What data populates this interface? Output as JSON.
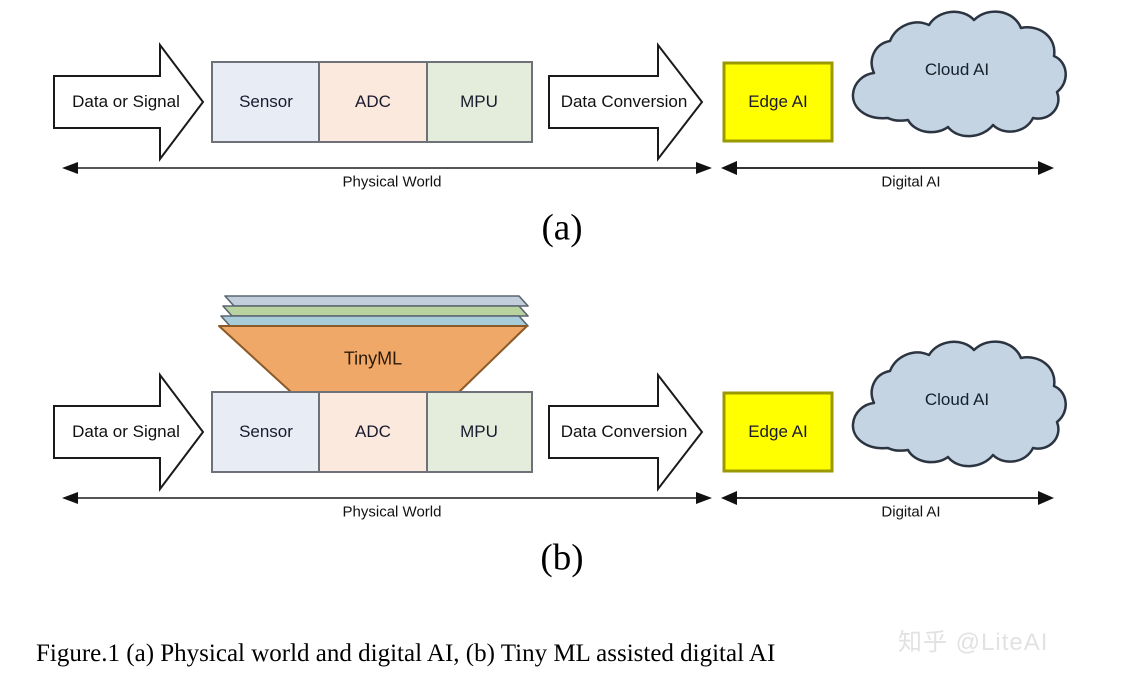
{
  "figure": {
    "caption": "Figure.1 (a) Physical world and digital AI, (b) Tiny ML assisted digital AI",
    "watermark": "知乎 @LiteAI",
    "background": "#ffffff"
  },
  "panels": [
    {
      "letter": "(a)",
      "input_arrow_label": "Data or Signal",
      "pipeline": [
        {
          "label": "Sensor",
          "fill": "#e8ecf5",
          "stroke": "#6f7179"
        },
        {
          "label": "ADC",
          "fill": "#fce9dd",
          "stroke": "#6f7179"
        },
        {
          "label": "MPU",
          "fill": "#e4ecdc",
          "stroke": "#6f7179"
        }
      ],
      "conversion_arrow_label": "Data Conversion",
      "edge_box": {
        "label": "Edge AI",
        "fill": "#ffff00",
        "stroke": "#9a9a00"
      },
      "cloud": {
        "label": "Cloud AI",
        "fill": "#c4d4e3",
        "stroke": "#2b3440"
      },
      "axes": [
        {
          "label": "Physical World",
          "style": "double-headed"
        },
        {
          "label": "Digital AI",
          "style": "double-headed"
        }
      ],
      "tinyml": null
    },
    {
      "letter": "(b)",
      "input_arrow_label": "Data or Signal",
      "pipeline": [
        {
          "label": "Sensor",
          "fill": "#e8ecf5",
          "stroke": "#6f7179"
        },
        {
          "label": "ADC",
          "fill": "#fce9dd",
          "stroke": "#6f7179"
        },
        {
          "label": "MPU",
          "fill": "#e4ecdc",
          "stroke": "#6f7179"
        }
      ],
      "conversion_arrow_label": "Data Conversion",
      "edge_box": {
        "label": "Edge AI",
        "fill": "#ffff00",
        "stroke": "#9a9a00"
      },
      "cloud": {
        "label": "Cloud AI",
        "fill": "#c4d4e3",
        "stroke": "#2b3440"
      },
      "axes": [
        {
          "label": "Physical World",
          "style": "double-headed"
        },
        {
          "label": "Digital AI",
          "style": "double-headed"
        }
      ],
      "tinyml": {
        "label": "TinyML",
        "trapezoid_fill": "#f0a868",
        "trapezoid_stroke": "#8a5a28",
        "layers": [
          {
            "fill": "#c3cedd",
            "stroke": "#5b6570"
          },
          {
            "fill": "#b8d3a0",
            "stroke": "#5b6570"
          },
          {
            "fill": "#a8ccd8",
            "stroke": "#5b6570"
          }
        ]
      }
    }
  ],
  "colors": {
    "block_arrow_fill": "#ffffff",
    "block_arrow_stroke": "#1a1a1a",
    "axis_line": "#555555",
    "axis_line_dark": "#111111",
    "text": "#111111"
  }
}
